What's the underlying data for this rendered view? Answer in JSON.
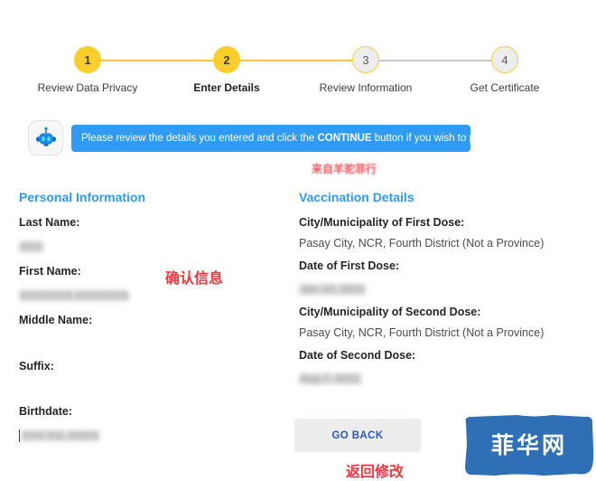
{
  "stepper": {
    "steps": [
      {
        "number": "1",
        "label": "Review Data Privacy",
        "state": "done"
      },
      {
        "number": "2",
        "label": "Enter Details",
        "state": "active"
      },
      {
        "number": "3",
        "label": "Review Information",
        "state": "todo"
      },
      {
        "number": "4",
        "label": "Get Certificate",
        "state": "todo"
      }
    ]
  },
  "assistant": {
    "icon": "robot-icon",
    "message_prefix": "Please review the details you entered and click the ",
    "message_bold": "CONTINUE",
    "message_suffix": " button if you wish to proceed."
  },
  "annotations": {
    "source_watermark": "来自羊驼菲行",
    "confirm_info": "确认信息",
    "go_back_note": "返回修改"
  },
  "personal_information": {
    "title": "Personal Information",
    "fields": [
      {
        "label": "Last Name:",
        "value": "XXX",
        "redacted": true,
        "caret": false
      },
      {
        "label": "First Name:",
        "value": "XXXXXXX XXXXXXX",
        "redacted": true,
        "caret": false
      },
      {
        "label": "Middle Name:",
        "value": "",
        "redacted": false,
        "caret": false
      },
      {
        "label": "Suffix:",
        "value": "",
        "redacted": false,
        "caret": false
      },
      {
        "label": "Birthdate:",
        "value": "XXX XX, XXXX",
        "redacted": true,
        "caret": true
      }
    ]
  },
  "vaccination_details": {
    "title": "Vaccination Details",
    "fields": [
      {
        "label": "City/Municipality of First Dose:",
        "value": "Pasay City, NCR, Fourth District (Not a Province)",
        "redacted": false,
        "caret": false
      },
      {
        "label": "Date of First Dose:",
        "value": "Jan 10, 2021",
        "redacted": true,
        "caret": false
      },
      {
        "label": "City/Municipality of Second Dose:",
        "value": "Pasay City, NCR, Fourth District (Not a Province)",
        "redacted": false,
        "caret": false
      },
      {
        "label": "Date of Second Dose:",
        "value": "Aug 7, 2021",
        "redacted": true,
        "caret": false
      }
    ]
  },
  "actions": {
    "go_back_label": "GO BACK"
  },
  "watermark": {
    "text": "菲华网"
  },
  "colors": {
    "step_done": "#FBCE2B",
    "step_todo_fill": "#EDEDED",
    "step_todo_border": "#F6CE4A",
    "connector_done": "#F8C83C",
    "connector_todo": "#C9C9C9",
    "banner_blue": "#2F9BF5",
    "section_title_blue": "#3398F4",
    "annotation_red": "#F4373F",
    "go_back_bg": "#EDEDED",
    "go_back_text": "#2B57C4",
    "watermark_blue": "#2F6FB5"
  }
}
